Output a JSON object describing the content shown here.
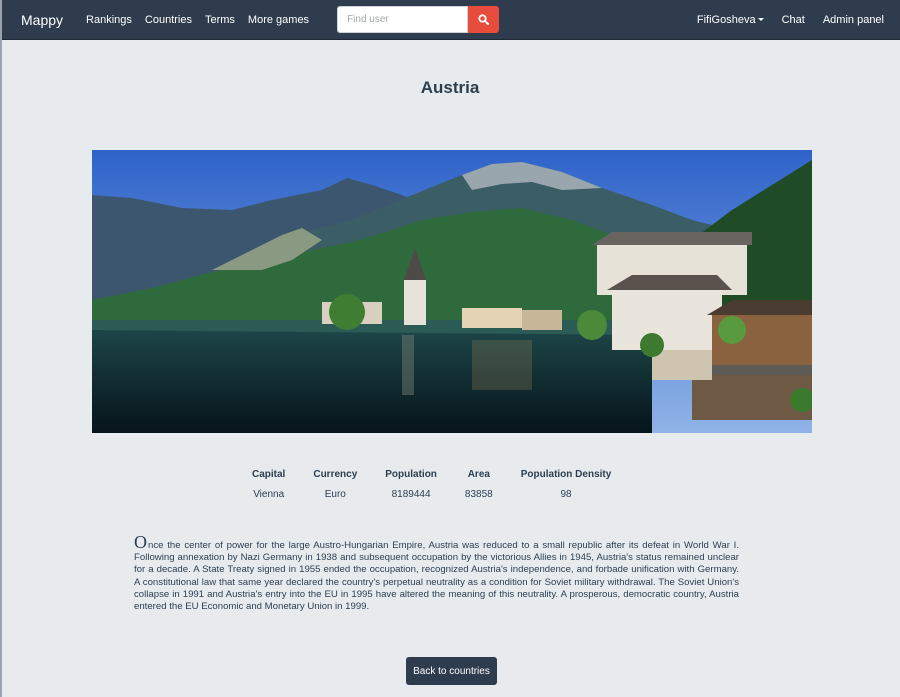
{
  "navbar": {
    "brand": "Mappy",
    "links": [
      "Rankings",
      "Countries",
      "Terms",
      "More games"
    ],
    "search": {
      "placeholder": "Find user",
      "value": ""
    },
    "search_icon": "search-icon",
    "user": "FifiGosheva",
    "right_links": [
      "Chat",
      "Admin panel"
    ]
  },
  "country": {
    "title": "Austria",
    "image_alt": "Alpine lakeside village with church spire and mountains"
  },
  "info": {
    "headers": [
      "Capital",
      "Currency",
      "Population",
      "Area",
      "Population Density"
    ],
    "values": [
      "Vienna",
      "Euro",
      "8189444",
      "83858",
      "98"
    ]
  },
  "description": {
    "first_letter": "O",
    "rest": "nce the center of power for the large Austro-Hungarian Empire, Austria was reduced to a small republic after its defeat in World War I. Following annexation by Nazi Germany in 1938 and subsequent occupation by the victorious Allies in 1945, Austria's status remained unclear for a decade. A State Treaty signed in 1955 ended the occupation, recognized Austria's independence, and forbade unification with Germany. A constitutional law that same year declared the country's perpetual neutrality as a condition for Soviet military withdrawal. The Soviet Union's collapse in 1991 and Austria's entry into the EU in 1995 have altered the meaning of this neutrality. A prosperous, democratic country, Austria entered the EU Economic and Monetary Union in 1999."
  },
  "back_button": "Back to countries",
  "colors": {
    "navbar": "#2f3c4d",
    "search_button": "#e74c3c",
    "page_bg": "#e8ebee",
    "text": "#2c3e50"
  }
}
